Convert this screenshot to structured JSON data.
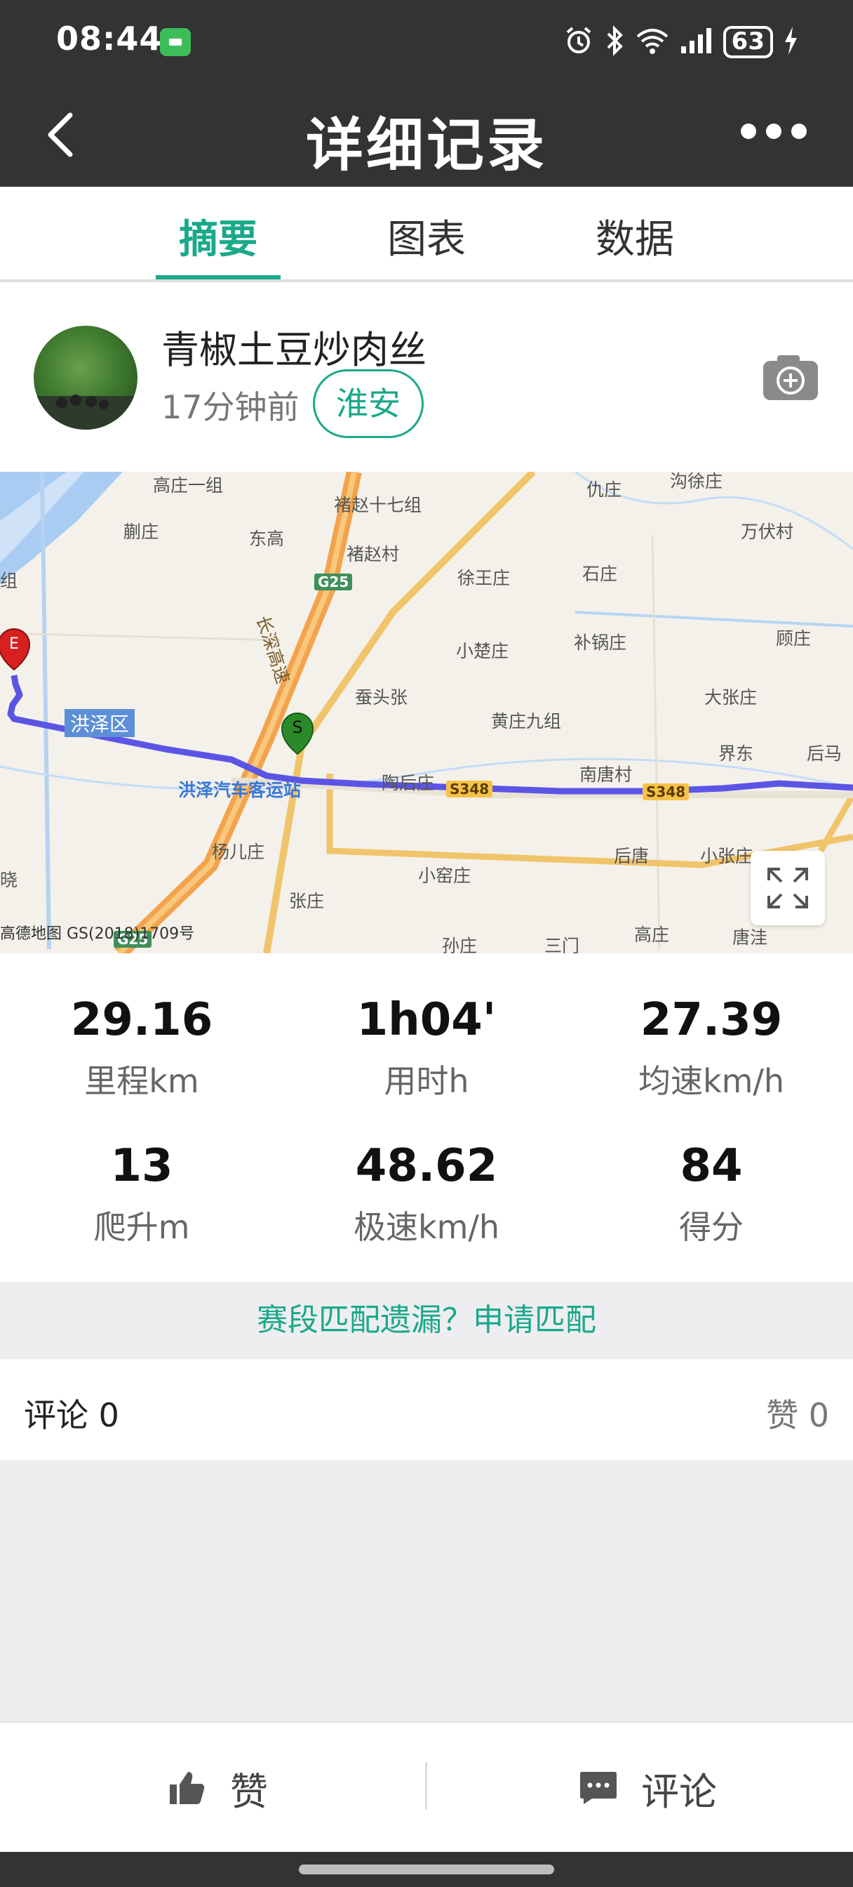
{
  "status_bar": {
    "time": "08:44",
    "battery": "63"
  },
  "header": {
    "title": "详细记录"
  },
  "tabs": [
    {
      "label": "摘要",
      "active": true
    },
    {
      "label": "图表",
      "active": false
    },
    {
      "label": "数据",
      "active": false
    }
  ],
  "user": {
    "name": "青椒土豆炒肉丝",
    "time_ago": "17分钟前",
    "city": "淮安"
  },
  "map": {
    "labels": [
      "高庄一组",
      "褚赵十七组",
      "仇庄",
      "沟徐庄",
      "蒯庄",
      "东高",
      "褚赵村",
      "万伏村",
      "徐王庄",
      "石庄",
      "小楚庄",
      "补锅庄",
      "顾庄",
      "蚕头张",
      "大张庄",
      "黄庄九组",
      "界东",
      "后马",
      "陶后庄",
      "南唐村",
      "杨儿庄",
      "后唐",
      "小张庄",
      "小窑庄",
      "张庄",
      "孙庄",
      "三门",
      "高庄",
      "唐洼",
      "组",
      "晓"
    ],
    "district": "洪泽区",
    "station": "洪泽汽车客运站",
    "highway": "长深高速",
    "roads": [
      "G25",
      "S348",
      "S348",
      "G25"
    ],
    "copyright": "高德地图 GS(2018)1709号",
    "start_marker": "S",
    "end_marker": "E"
  },
  "stats": [
    {
      "value": "29.16",
      "label": "里程km"
    },
    {
      "value": "1h04'",
      "label": "用时h"
    },
    {
      "value": "27.39",
      "label": "均速km/h"
    },
    {
      "value": "13",
      "label": "爬升m"
    },
    {
      "value": "48.62",
      "label": "极速km/h"
    },
    {
      "value": "84",
      "label": "得分"
    }
  ],
  "segment": {
    "text": "赛段匹配遗漏？申请匹配"
  },
  "comments": {
    "comment_label": "评论 0",
    "like_label": "赞 0"
  },
  "bottom": {
    "like": "赞",
    "comment": "评论"
  },
  "colors": {
    "accent": "#1aa98a",
    "header": "#333333",
    "route": "#5b55e6"
  }
}
